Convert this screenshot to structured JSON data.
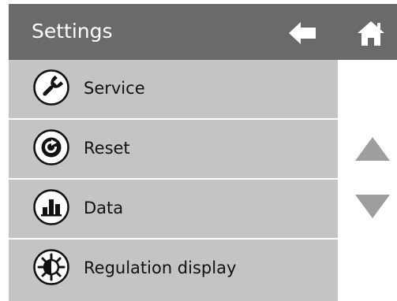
{
  "header": {
    "title": "Settings",
    "back_icon": "arrow-left-icon",
    "home_icon": "home-icon"
  },
  "menu": {
    "items": [
      {
        "label": "Service",
        "icon": "wrench-icon"
      },
      {
        "label": "Reset",
        "icon": "reset-icon"
      },
      {
        "label": "Data",
        "icon": "bar-chart-icon"
      },
      {
        "label": "Regulation display",
        "icon": "regulation-icon"
      }
    ]
  },
  "scroll": {
    "up_icon": "triangle-up-icon",
    "down_icon": "triangle-down-icon"
  },
  "colors": {
    "header_bg": "#6a6a6a",
    "item_bg": "#c4c4c4",
    "icon_light": "#ffffff",
    "arrow": "#9e9e9e",
    "text": "#111111"
  }
}
